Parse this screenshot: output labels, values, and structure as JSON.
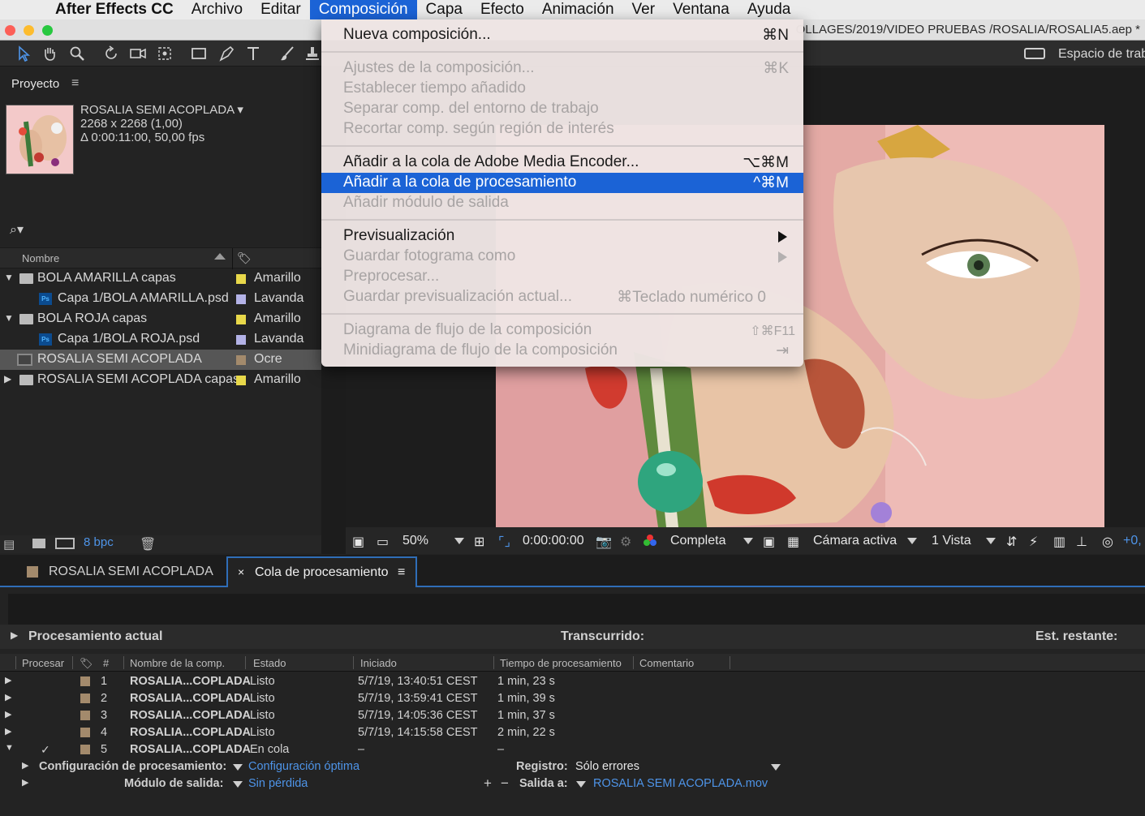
{
  "menubar": {
    "app": "After Effects CC",
    "items": [
      "Archivo",
      "Editar",
      "Composición",
      "Capa",
      "Efecto",
      "Animación",
      "Ver",
      "Ventana",
      "Ayuda"
    ],
    "active": "Composición"
  },
  "titlebar": {
    "path": "OLLAGES/2019/VIDEO PRUEBAS /ROSALIA/ROSALIA5.aep *"
  },
  "toolbar": {
    "workspace_label": "Espacio de trab"
  },
  "project": {
    "title": "Proyecto",
    "comp_name": "ROSALIA SEMI ACOPLADA ▾",
    "comp_size": "2268 x 2268 (1,00)",
    "comp_duration": "Δ 0:00:11:00, 50,00 fps",
    "col_name": "Nombre",
    "items": [
      {
        "name": "BOLA AMARILLA capas",
        "label": "Amarillo",
        "color": "#e8d84a"
      },
      {
        "name": "Capa 1/BOLA AMARILLA.psd",
        "label": "Lavanda",
        "color": "#b3b2e6"
      },
      {
        "name": "BOLA ROJA capas",
        "label": "Amarillo",
        "color": "#e8d84a"
      },
      {
        "name": "Capa 1/BOLA ROJA.psd",
        "label": "Lavanda",
        "color": "#b3b2e6"
      },
      {
        "name": "ROSALIA SEMI ACOPLADA",
        "label": "Ocre",
        "color": "#a38a6c"
      },
      {
        "name": "ROSALIA SEMI ACOPLADA capas",
        "label": "Amarillo",
        "color": "#e8d84a"
      }
    ],
    "bpc": "8 bpc"
  },
  "viewer": {
    "zoom": "50%",
    "timecode": "0:00:00:00",
    "resolution": "Completa",
    "camera": "Cámara activa",
    "views": "1 Vista",
    "exposure": "+0,"
  },
  "menu": {
    "items": [
      {
        "label": "Nueva composición...",
        "key": "⌘N",
        "state": "enabled"
      },
      {
        "label": "Ajustes de la composición...",
        "key": "⌘K",
        "state": "disabled"
      },
      {
        "label": "Establecer tiempo añadido",
        "key": "",
        "state": "disabled"
      },
      {
        "label": "Separar comp. del entorno de trabajo",
        "key": "",
        "state": "disabled"
      },
      {
        "label": "Recortar comp. según región de interés",
        "key": "",
        "state": "disabled"
      },
      {
        "label": "Añadir a la cola de Adobe Media Encoder...",
        "key": "⌥⌘M",
        "state": "enabled"
      },
      {
        "label": "Añadir a la cola de procesamiento",
        "key": "^⌘M",
        "state": "highlighted"
      },
      {
        "label": "Añadir módulo de salida",
        "key": "",
        "state": "disabled"
      },
      {
        "label": "Previsualización",
        "key": "",
        "state": "enabled"
      },
      {
        "label": "Guardar fotograma como",
        "key": "",
        "state": "disabled"
      },
      {
        "label": "Preprocesar...",
        "key": "",
        "state": "disabled"
      },
      {
        "label": "Guardar previsualización actual...",
        "key": "⌘Teclado numérico 0",
        "state": "disabled"
      },
      {
        "label": "Diagrama de flujo de la composición",
        "key": "⇧⌘F11",
        "state": "disabled"
      },
      {
        "label": "Minidiagrama de flujo de la composición",
        "key": "⇥",
        "state": "disabled"
      }
    ]
  },
  "render_queue": {
    "tab_comp": "ROSALIA SEMI ACOPLADA",
    "tab_queue": "Cola de procesamiento",
    "current": "Procesamiento actual",
    "elapsed": "Transcurrido:",
    "remaining": "Est. restante:",
    "columns": [
      "Procesar",
      "#",
      "Nombre de la comp.",
      "Estado",
      "Iniciado",
      "Tiempo de procesamiento",
      "Comentario"
    ],
    "rows": [
      {
        "num": "1",
        "comp": "ROSALIA...COPLADA",
        "status": "Listo",
        "started": "5/7/19, 13:40:51 CEST",
        "time": "1 min, 23 s",
        "checked": false
      },
      {
        "num": "2",
        "comp": "ROSALIA...COPLADA",
        "status": "Listo",
        "started": "5/7/19, 13:59:41 CEST",
        "time": "1 min, 39 s",
        "checked": false
      },
      {
        "num": "3",
        "comp": "ROSALIA...COPLADA",
        "status": "Listo",
        "started": "5/7/19, 14:05:36 CEST",
        "time": "1 min, 37 s",
        "checked": false
      },
      {
        "num": "4",
        "comp": "ROSALIA...COPLADA",
        "status": "Listo",
        "started": "5/7/19, 14:15:58 CEST",
        "time": "2 min, 22 s",
        "checked": false
      },
      {
        "num": "5",
        "comp": "ROSALIA...COPLADA",
        "status": "En cola",
        "started": "–",
        "time": "–",
        "checked": true
      }
    ],
    "render_settings_label": "Configuración de procesamiento:",
    "render_settings_value": "Configuración óptima",
    "log_label": "Registro:",
    "log_value": "Sólo errores",
    "output_module_label": "Módulo de salida:",
    "output_module_value": "Sin pérdida",
    "output_to_label": "Salida a:",
    "output_to_value": "ROSALIA SEMI ACOPLADA.mov"
  }
}
